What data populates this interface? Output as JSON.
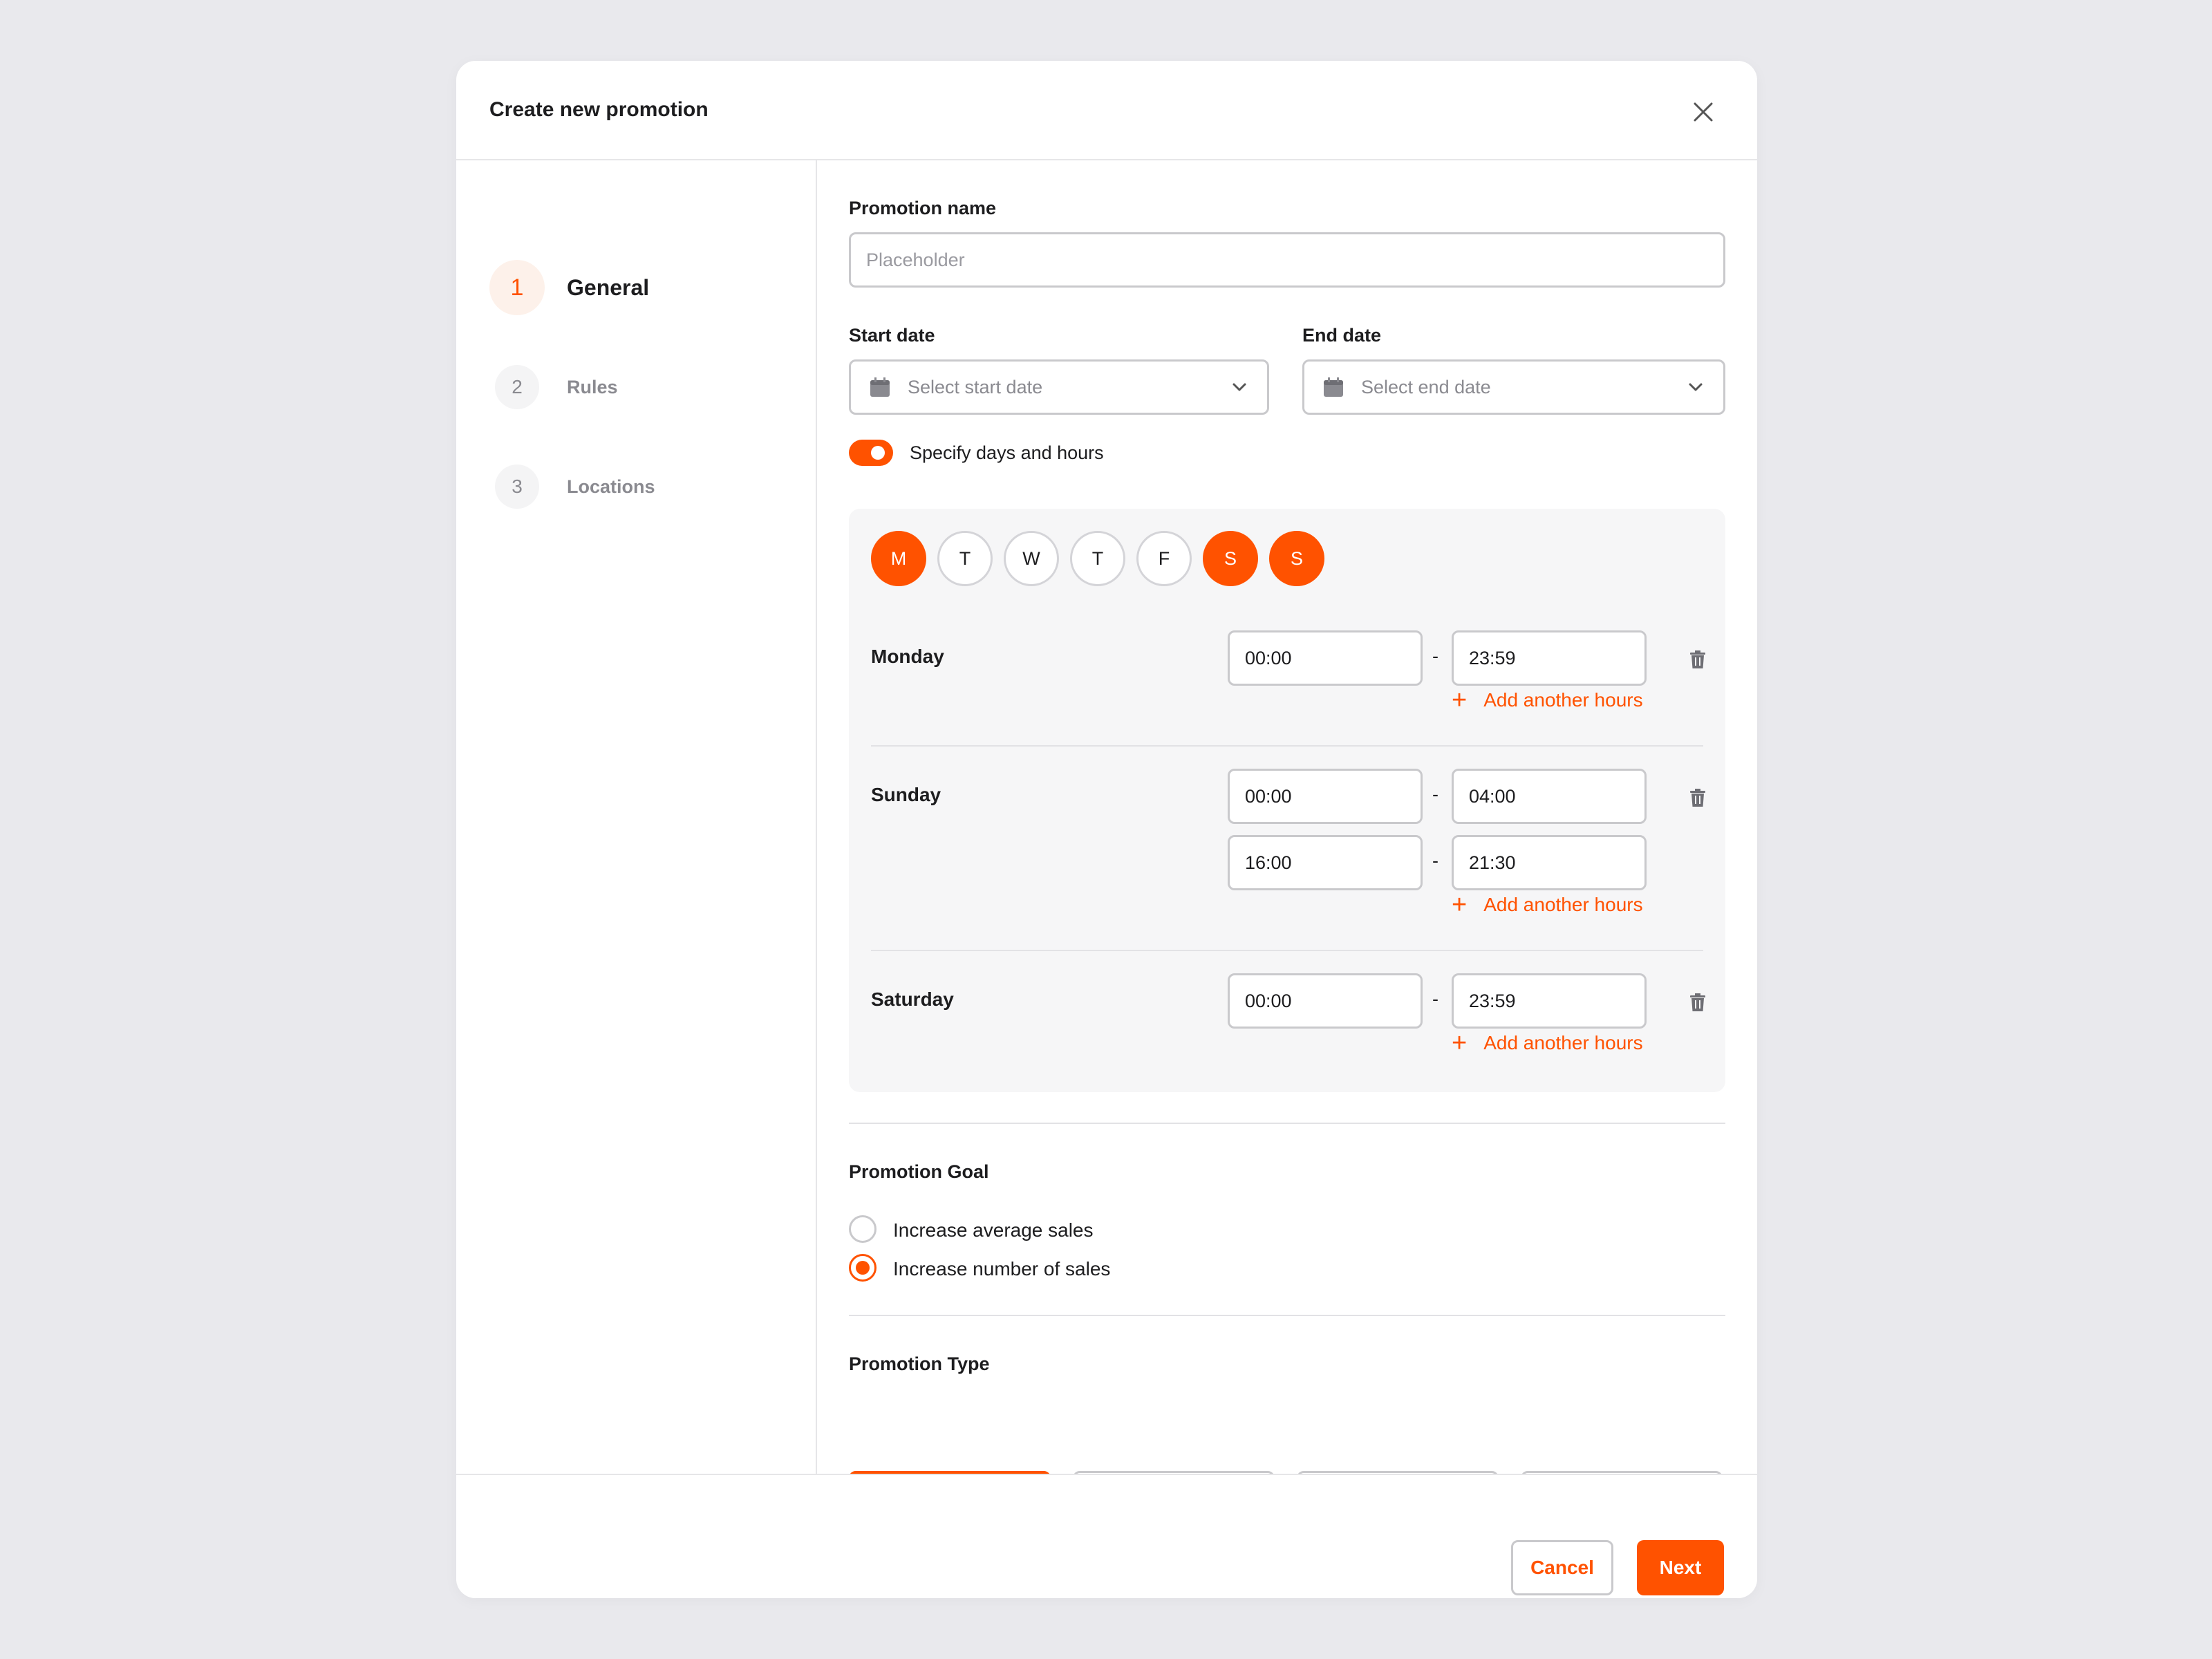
{
  "modal": {
    "title": "Create new promotion"
  },
  "steps": [
    {
      "number": "1",
      "label": "General",
      "active": true
    },
    {
      "number": "2",
      "label": "Rules",
      "active": false
    },
    {
      "number": "3",
      "label": "Locations",
      "active": false
    }
  ],
  "form": {
    "promotion_name": {
      "label": "Promotion name",
      "placeholder": "Placeholder",
      "value": ""
    },
    "start_date": {
      "label": "Start date",
      "placeholder": "Select start date"
    },
    "end_date": {
      "label": "End date",
      "placeholder": "Select end date"
    },
    "specify_days": {
      "label": "Specify days and hours",
      "enabled": true
    }
  },
  "days": [
    {
      "letter": "M",
      "selected": true
    },
    {
      "letter": "T",
      "selected": false
    },
    {
      "letter": "W",
      "selected": false
    },
    {
      "letter": "T",
      "selected": false
    },
    {
      "letter": "F",
      "selected": false
    },
    {
      "letter": "S",
      "selected": true
    },
    {
      "letter": "S",
      "selected": true
    }
  ],
  "schedule": [
    {
      "day": "Monday",
      "ranges": [
        {
          "from": "00:00",
          "to": "23:59"
        }
      ]
    },
    {
      "day": "Sunday",
      "ranges": [
        {
          "from": "00:00",
          "to": "04:00"
        },
        {
          "from": "16:00",
          "to": "21:30"
        }
      ]
    },
    {
      "day": "Saturday",
      "ranges": [
        {
          "from": "00:00",
          "to": "23:59"
        }
      ]
    }
  ],
  "range_separator": "-",
  "add_hours_label": "Add another hours",
  "goal": {
    "label": "Promotion Goal",
    "options": [
      {
        "label": "Increase average sales",
        "selected": false
      },
      {
        "label": "Increase number of sales",
        "selected": true
      }
    ]
  },
  "type": {
    "label": "Promotion Type",
    "options": [
      {
        "icon": "percent-icon",
        "selected": true
      },
      {
        "icon": "dollar-icon",
        "selected": false
      },
      {
        "icon": "food-icon",
        "selected": false
      },
      {
        "icon": "tag-icon",
        "selected": false
      }
    ]
  },
  "footer": {
    "cancel_label": "Cancel",
    "next_label": "Next"
  },
  "colors": {
    "accent": "#ff5200",
    "background": "#e9e9ed"
  }
}
